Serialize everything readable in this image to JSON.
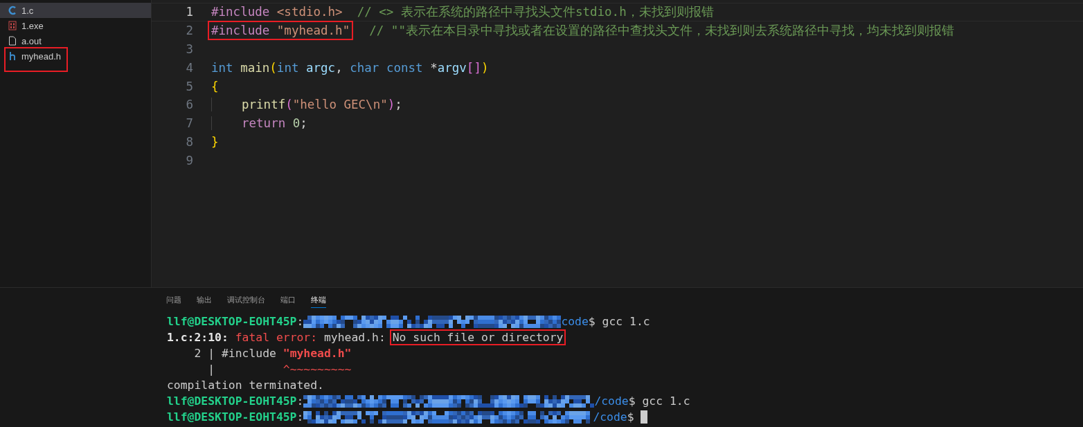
{
  "explorer": {
    "files": [
      {
        "name": "1.c",
        "kind": "c",
        "selected": true,
        "highlighted": false
      },
      {
        "name": "1.exe",
        "kind": "exe",
        "selected": false,
        "highlighted": false
      },
      {
        "name": "a.out",
        "kind": "file",
        "selected": false,
        "highlighted": false
      },
      {
        "name": "myhead.h",
        "kind": "h",
        "selected": false,
        "highlighted": true
      }
    ]
  },
  "editor": {
    "lines": [
      {
        "number": "1",
        "current": true,
        "segments": [
          {
            "boxed": false,
            "tokens": [
              {
                "kind": "directive",
                "text": "#include "
              },
              {
                "kind": "string",
                "text": "<stdio.h>"
              },
              {
                "kind": "comment",
                "text": "  // <> 表示在系统的路径中寻找头文件stdio.h，未找到则报错"
              }
            ]
          }
        ]
      },
      {
        "number": "2",
        "current": false,
        "segments": [
          {
            "boxed": true,
            "tokens": [
              {
                "kind": "directive",
                "text": "#include "
              },
              {
                "kind": "string",
                "text": "\"myhead.h\""
              }
            ]
          },
          {
            "boxed": false,
            "tokens": [
              {
                "kind": "comment",
                "text": "  // \"\"表示在本目录中寻找或者在设置的路径中查找头文件，未找到则去系统路径中寻找，均未找到则报错"
              }
            ]
          }
        ]
      },
      {
        "number": "3",
        "current": false
      },
      {
        "number": "4",
        "current": false,
        "segments": [
          {
            "boxed": false,
            "tokens": [
              {
                "kind": "keyword",
                "text": "int "
              },
              {
                "kind": "function",
                "text": "main"
              },
              {
                "kind": "bracket",
                "text": "("
              },
              {
                "kind": "keyword",
                "text": "int "
              },
              {
                "kind": "param",
                "text": "argc"
              },
              {
                "kind": "plain",
                "text": ", "
              },
              {
                "kind": "keyword",
                "text": "char const "
              },
              {
                "kind": "plain",
                "text": "*"
              },
              {
                "kind": "param",
                "text": "argv"
              },
              {
                "kind": "bracket2",
                "text": "[]"
              },
              {
                "kind": "bracket",
                "text": ")"
              }
            ]
          }
        ]
      },
      {
        "number": "5",
        "current": false,
        "segments": [
          {
            "boxed": false,
            "tokens": [
              {
                "kind": "bracket",
                "text": "{"
              }
            ]
          }
        ]
      },
      {
        "number": "6",
        "current": false,
        "guide": true,
        "segments": [
          {
            "boxed": false,
            "tokens": [
              {
                "kind": "function",
                "text": "printf"
              },
              {
                "kind": "bracket2",
                "text": "("
              },
              {
                "kind": "string",
                "text": "\"hello GEC\\n\""
              },
              {
                "kind": "bracket2",
                "text": ")"
              },
              {
                "kind": "plain",
                "text": ";"
              }
            ]
          }
        ]
      },
      {
        "number": "7",
        "current": false,
        "guide": true,
        "segments": [
          {
            "boxed": false,
            "tokens": [
              {
                "kind": "control",
                "text": "return "
              },
              {
                "kind": "number",
                "text": "0"
              },
              {
                "kind": "plain",
                "text": ";"
              }
            ]
          }
        ]
      },
      {
        "number": "8",
        "current": false,
        "segments": [
          {
            "boxed": false,
            "tokens": [
              {
                "kind": "bracket",
                "text": "}"
              }
            ]
          }
        ]
      },
      {
        "number": "9",
        "current": false
      }
    ]
  },
  "panel": {
    "tabs": [
      {
        "label": "问题",
        "selected": false
      },
      {
        "label": "输出",
        "selected": false
      },
      {
        "label": "调试控制台",
        "selected": false
      },
      {
        "label": "端口",
        "selected": false
      },
      {
        "label": "终端",
        "selected": true
      }
    ],
    "terminal": {
      "lines": [
        [
          {
            "kind": "text",
            "boxed": false,
            "tokens": [
              {
                "kind": "prompt",
                "text": "llf@DESKTOP-EOHT45P"
              },
              {
                "kind": "plain",
                "text": ":"
              }
            ]
          },
          {
            "kind": "redacted"
          },
          {
            "kind": "text",
            "boxed": false,
            "tokens": [
              {
                "kind": "path",
                "text": "code"
              },
              {
                "kind": "plain",
                "text": "$ gcc 1.c"
              }
            ]
          }
        ],
        [
          {
            "kind": "text",
            "boxed": false,
            "tokens": [
              {
                "kind": "bold",
                "text": "1.c:2:10: "
              },
              {
                "kind": "error",
                "text": "fatal error: "
              },
              {
                "kind": "plain",
                "text": "myhead.h: "
              }
            ]
          },
          {
            "kind": "text",
            "boxed": true,
            "tokens": [
              {
                "kind": "plain",
                "text": "No such file or directory"
              }
            ]
          }
        ],
        [
          {
            "kind": "text",
            "boxed": false,
            "tokens": [
              {
                "kind": "plain",
                "text": "    2 | #include "
              },
              {
                "kind": "errbold",
                "text": "\"myhead.h\""
              }
            ]
          }
        ],
        [
          {
            "kind": "text",
            "boxed": false,
            "tokens": [
              {
                "kind": "plain",
                "text": "      |          "
              },
              {
                "kind": "error",
                "text": "^~~~~~~~~~"
              }
            ]
          }
        ],
        [
          {
            "kind": "text",
            "boxed": false,
            "tokens": [
              {
                "kind": "plain",
                "text": "compilation terminated."
              }
            ]
          }
        ],
        [
          {
            "kind": "text",
            "boxed": false,
            "tokens": [
              {
                "kind": "prompt",
                "text": "llf@DESKTOP-EOHT45P"
              },
              {
                "kind": "plain",
                "text": ":"
              }
            ]
          },
          {
            "kind": "redacted"
          },
          {
            "kind": "text",
            "boxed": false,
            "tokens": [
              {
                "kind": "path",
                "text": "/code"
              },
              {
                "kind": "plain",
                "text": "$ gcc 1.c"
              }
            ]
          }
        ],
        [
          {
            "kind": "text",
            "boxed": false,
            "tokens": [
              {
                "kind": "prompt",
                "text": "llf@DESKTOP-EOHT45P"
              },
              {
                "kind": "plain",
                "text": ":"
              }
            ]
          },
          {
            "kind": "redacted"
          },
          {
            "kind": "text",
            "boxed": false,
            "tokens": [
              {
                "kind": "path",
                "text": "/code"
              },
              {
                "kind": "plain",
                "text": "$ "
              }
            ]
          },
          {
            "kind": "cursor"
          }
        ]
      ]
    }
  }
}
